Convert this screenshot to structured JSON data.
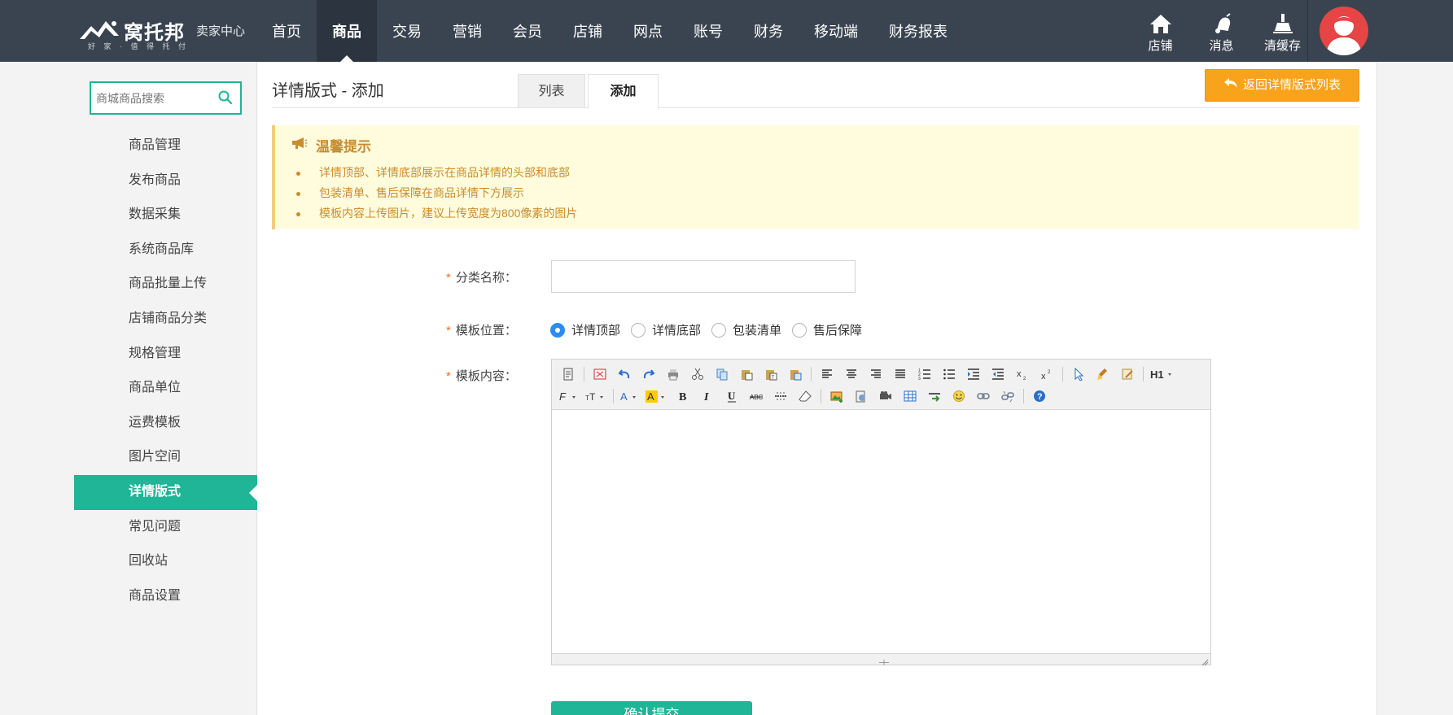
{
  "header": {
    "logo_brand": "窝托邦",
    "logo_slogan": "好 家 · 值 得 托 付",
    "logo_center": "卖家中心",
    "nav": [
      "首页",
      "商品",
      "交易",
      "营销",
      "会员",
      "店铺",
      "网点",
      "账号",
      "财务",
      "移动端",
      "财务报表"
    ],
    "nav_active": "商品",
    "tools": [
      {
        "label": "店铺",
        "icon": "home-icon"
      },
      {
        "label": "消息",
        "icon": "bell-icon"
      },
      {
        "label": "清缓存",
        "icon": "broom-icon"
      }
    ]
  },
  "sidebar": {
    "search_placeholder": "商城商品搜索",
    "items": [
      "商品管理",
      "发布商品",
      "数据采集",
      "系统商品库",
      "商品批量上传",
      "店铺商品分类",
      "规格管理",
      "商品单位",
      "运费模板",
      "图片空间",
      "详情版式",
      "常见问题",
      "回收站",
      "商品设置"
    ],
    "active": "详情版式"
  },
  "main": {
    "title": "详情版式 - 添加",
    "tabs": [
      "列表",
      "添加"
    ],
    "active_tab": "添加",
    "back_button": "返回详情版式列表",
    "tip": {
      "title": "温馨提示",
      "items": [
        "详情顶部、详情底部展示在商品详情的头部和底部",
        "包装清单、售后保障在商品详情下方展示",
        "模板内容上传图片，建议上传宽度为800像素的图片"
      ]
    },
    "form": {
      "name_label": "分类名称：",
      "name_value": "",
      "position_label": "模板位置：",
      "positions": [
        "详情顶部",
        "详情底部",
        "包装清单",
        "售后保障"
      ],
      "position_selected": "详情顶部",
      "content_label": "模板内容：",
      "submit_label": "确认提交"
    }
  },
  "colors": {
    "topbar": "#3a4451",
    "accent": "#1fb596",
    "warning": "#f9a21b",
    "tip_bg": "#fefcdc",
    "tip_text": "#c98c2e"
  }
}
